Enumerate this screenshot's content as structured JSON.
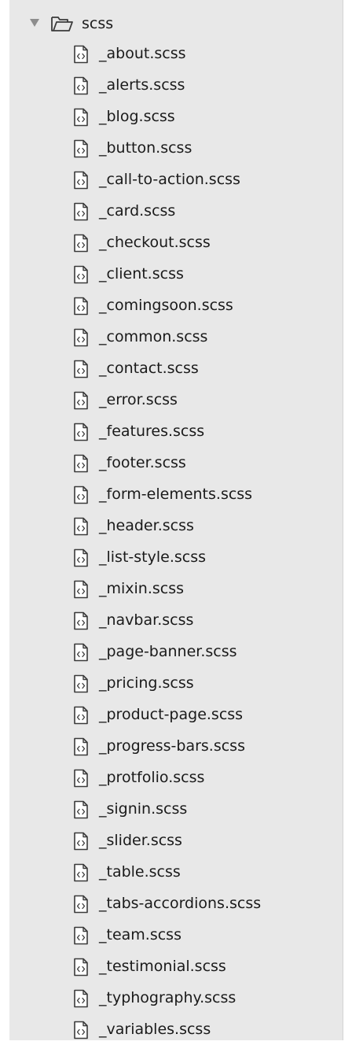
{
  "folder": {
    "name": "scss",
    "expanded": true,
    "icon": "folder-open-icon"
  },
  "files": [
    {
      "name": "_about.scss",
      "icon": "scss-file-icon"
    },
    {
      "name": "_alerts.scss",
      "icon": "scss-file-icon"
    },
    {
      "name": "_blog.scss",
      "icon": "scss-file-icon"
    },
    {
      "name": "_button.scss",
      "icon": "scss-file-icon"
    },
    {
      "name": "_call-to-action.scss",
      "icon": "scss-file-icon"
    },
    {
      "name": "_card.scss",
      "icon": "scss-file-icon"
    },
    {
      "name": "_checkout.scss",
      "icon": "scss-file-icon"
    },
    {
      "name": "_client.scss",
      "icon": "scss-file-icon"
    },
    {
      "name": "_comingsoon.scss",
      "icon": "scss-file-icon"
    },
    {
      "name": "_common.scss",
      "icon": "scss-file-icon"
    },
    {
      "name": "_contact.scss",
      "icon": "scss-file-icon"
    },
    {
      "name": "_error.scss",
      "icon": "scss-file-icon"
    },
    {
      "name": "_features.scss",
      "icon": "scss-file-icon"
    },
    {
      "name": "_footer.scss",
      "icon": "scss-file-icon"
    },
    {
      "name": "_form-elements.scss",
      "icon": "scss-file-icon"
    },
    {
      "name": "_header.scss",
      "icon": "scss-file-icon"
    },
    {
      "name": "_list-style.scss",
      "icon": "scss-file-icon"
    },
    {
      "name": "_mixin.scss",
      "icon": "scss-file-icon"
    },
    {
      "name": "_navbar.scss",
      "icon": "scss-file-icon"
    },
    {
      "name": "_page-banner.scss",
      "icon": "scss-file-icon"
    },
    {
      "name": "_pricing.scss",
      "icon": "scss-file-icon"
    },
    {
      "name": "_product-page.scss",
      "icon": "scss-file-icon"
    },
    {
      "name": "_progress-bars.scss",
      "icon": "scss-file-icon"
    },
    {
      "name": "_protfolio.scss",
      "icon": "scss-file-icon"
    },
    {
      "name": "_signin.scss",
      "icon": "scss-file-icon"
    },
    {
      "name": "_slider.scss",
      "icon": "scss-file-icon"
    },
    {
      "name": "_table.scss",
      "icon": "scss-file-icon"
    },
    {
      "name": "_tabs-accordions.scss",
      "icon": "scss-file-icon"
    },
    {
      "name": "_team.scss",
      "icon": "scss-file-icon"
    },
    {
      "name": "_testimonial.scss",
      "icon": "scss-file-icon"
    },
    {
      "name": "_typhography.scss",
      "icon": "scss-file-icon"
    },
    {
      "name": "_variables.scss",
      "icon": "scss-file-icon"
    }
  ],
  "colors": {
    "panel_background": "#e8e8e8",
    "text": "#1a1a1a",
    "icon_stroke": "#3a3a3a",
    "disclosure_triangle": "#8d8d8d"
  }
}
